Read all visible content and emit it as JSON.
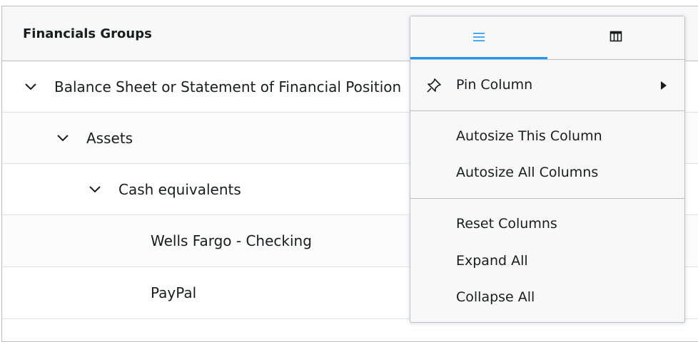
{
  "grid": {
    "header_title": "Financials Groups",
    "rows": [
      {
        "label": "Balance Sheet or Statement of Financial Position",
        "expanded": true
      },
      {
        "label": "Assets",
        "expanded": true
      },
      {
        "label": "Cash equivalents",
        "expanded": true
      },
      {
        "label": "Wells Fargo - Checking"
      },
      {
        "label": "PayPal"
      }
    ]
  },
  "menu": {
    "tabs": [
      {
        "icon": "general-menu-icon",
        "active": true
      },
      {
        "icon": "columns-icon",
        "active": false
      }
    ],
    "items": {
      "pin_column": "Pin Column",
      "autosize_this": "Autosize This Column",
      "autosize_all": "Autosize All Columns",
      "reset_columns": "Reset Columns",
      "expand_all": "Expand All",
      "collapse_all": "Collapse All"
    },
    "accent_color": "#2196f3"
  }
}
